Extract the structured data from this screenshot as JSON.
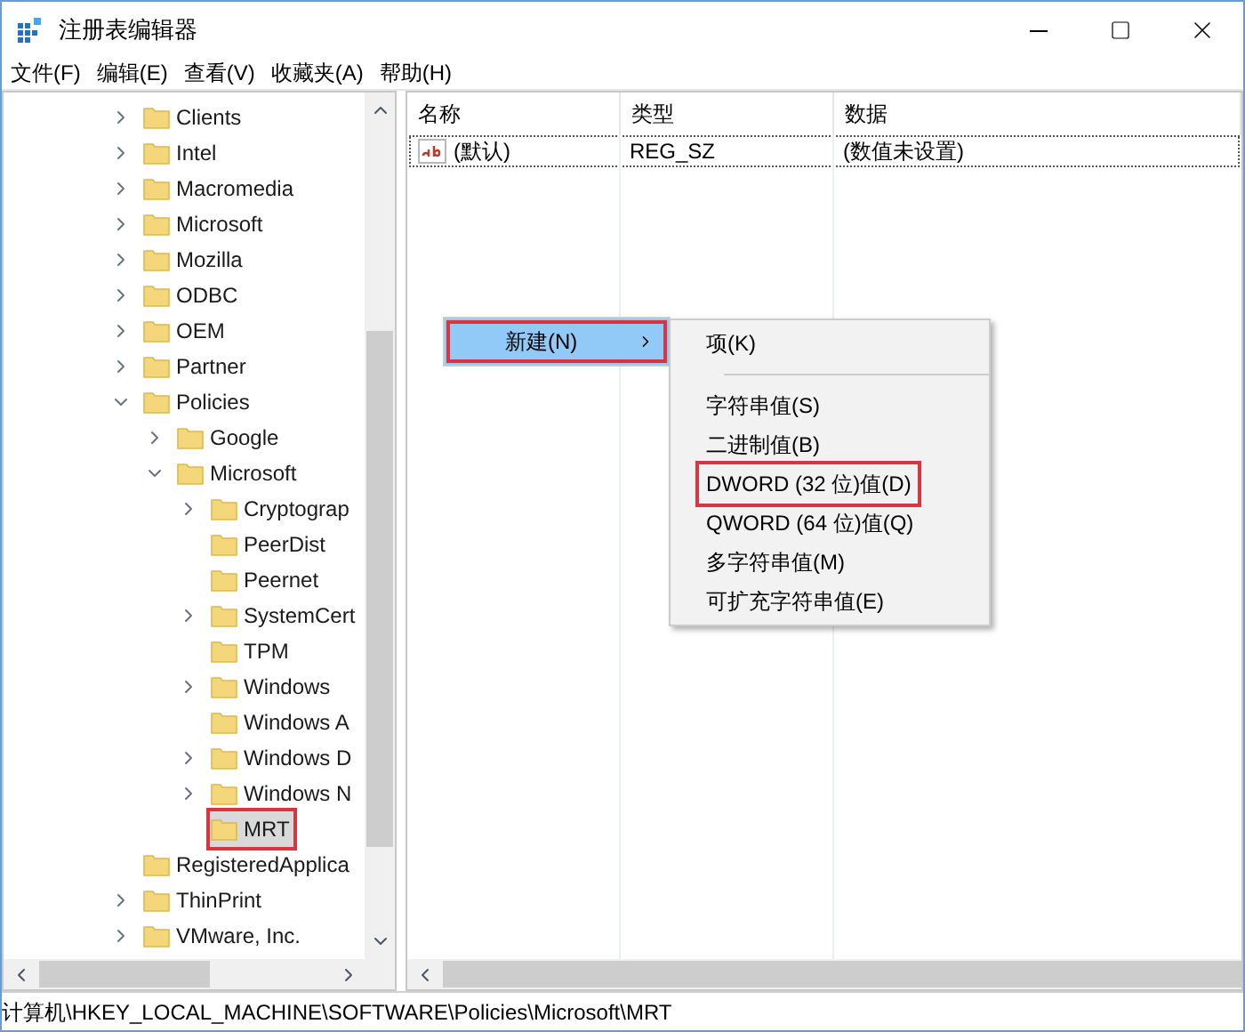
{
  "window": {
    "title": "注册表编辑器"
  },
  "menu": [
    "文件(F)",
    "编辑(E)",
    "查看(V)",
    "收藏夹(A)",
    "帮助(H)"
  ],
  "tree": [
    {
      "label": "Clients",
      "expandable": true,
      "expanded": false,
      "selected": false,
      "annotated": false
    },
    {
      "label": "Intel",
      "expandable": true,
      "expanded": false,
      "selected": false,
      "annotated": false
    },
    {
      "label": "Macromedia",
      "expandable": true,
      "expanded": false,
      "selected": false,
      "annotated": false
    },
    {
      "label": "Microsoft",
      "expandable": true,
      "expanded": false,
      "selected": false,
      "annotated": false
    },
    {
      "label": "Mozilla",
      "expandable": true,
      "expanded": false,
      "selected": false,
      "annotated": false
    },
    {
      "label": "ODBC",
      "expandable": true,
      "expanded": false,
      "selected": false,
      "annotated": false
    },
    {
      "label": "OEM",
      "expandable": true,
      "expanded": false,
      "selected": false,
      "annotated": false
    },
    {
      "label": "Partner",
      "expandable": true,
      "expanded": false,
      "selected": false,
      "annotated": false
    },
    {
      "label": "Policies",
      "expandable": true,
      "expanded": true,
      "selected": false,
      "annotated": false,
      "children": [
        {
          "label": "Google",
          "expandable": true,
          "expanded": false,
          "selected": false,
          "annotated": false
        },
        {
          "label": "Microsoft",
          "expandable": true,
          "expanded": true,
          "selected": false,
          "annotated": false,
          "children": [
            {
              "label": "Cryptograp",
              "expandable": true,
              "expanded": false,
              "selected": false,
              "annotated": false
            },
            {
              "label": "PeerDist",
              "expandable": false,
              "selected": false,
              "annotated": false
            },
            {
              "label": "Peernet",
              "expandable": false,
              "selected": false,
              "annotated": false
            },
            {
              "label": "SystemCert",
              "expandable": true,
              "expanded": false,
              "selected": false,
              "annotated": false
            },
            {
              "label": "TPM",
              "expandable": false,
              "selected": false,
              "annotated": false
            },
            {
              "label": "Windows",
              "expandable": true,
              "expanded": false,
              "selected": false,
              "annotated": false
            },
            {
              "label": "Windows A",
              "expandable": false,
              "selected": false,
              "annotated": false
            },
            {
              "label": "Windows D",
              "expandable": true,
              "expanded": false,
              "selected": false,
              "annotated": false
            },
            {
              "label": "Windows N",
              "expandable": true,
              "expanded": false,
              "selected": false,
              "annotated": false
            },
            {
              "label": "MRT",
              "expandable": false,
              "selected": true,
              "annotated": true
            }
          ]
        }
      ]
    },
    {
      "label": "RegisteredApplica",
      "expandable": false,
      "selected": false,
      "annotated": false
    },
    {
      "label": "ThinPrint",
      "expandable": true,
      "expanded": false,
      "selected": false,
      "annotated": false
    },
    {
      "label": "VMware, Inc.",
      "expandable": true,
      "expanded": false,
      "selected": false,
      "annotated": false
    }
  ],
  "table": {
    "columns": [
      "名称",
      "类型",
      "数据"
    ],
    "rows": [
      [
        "(默认)",
        "REG_SZ",
        "(数值未设置)"
      ]
    ]
  },
  "context_menu": {
    "item": {
      "label": "新建(N)",
      "annotated": true
    },
    "submenu_groups": [
      [
        {
          "label": "项(K)",
          "annotated": false
        }
      ],
      [
        {
          "label": "字符串值(S)",
          "annotated": false
        },
        {
          "label": "二进制值(B)",
          "annotated": false
        },
        {
          "label": "DWORD (32 位)值(D)",
          "annotated": true
        },
        {
          "label": "QWORD (64 位)值(Q)",
          "annotated": false
        },
        {
          "label": "多字符串值(M)",
          "annotated": false
        },
        {
          "label": "可扩充字符串值(E)",
          "annotated": false
        }
      ]
    ]
  },
  "status_bar": "计算机\\HKEY_LOCAL_MACHINE\\SOFTWARE\\Policies\\Microsoft\\MRT"
}
